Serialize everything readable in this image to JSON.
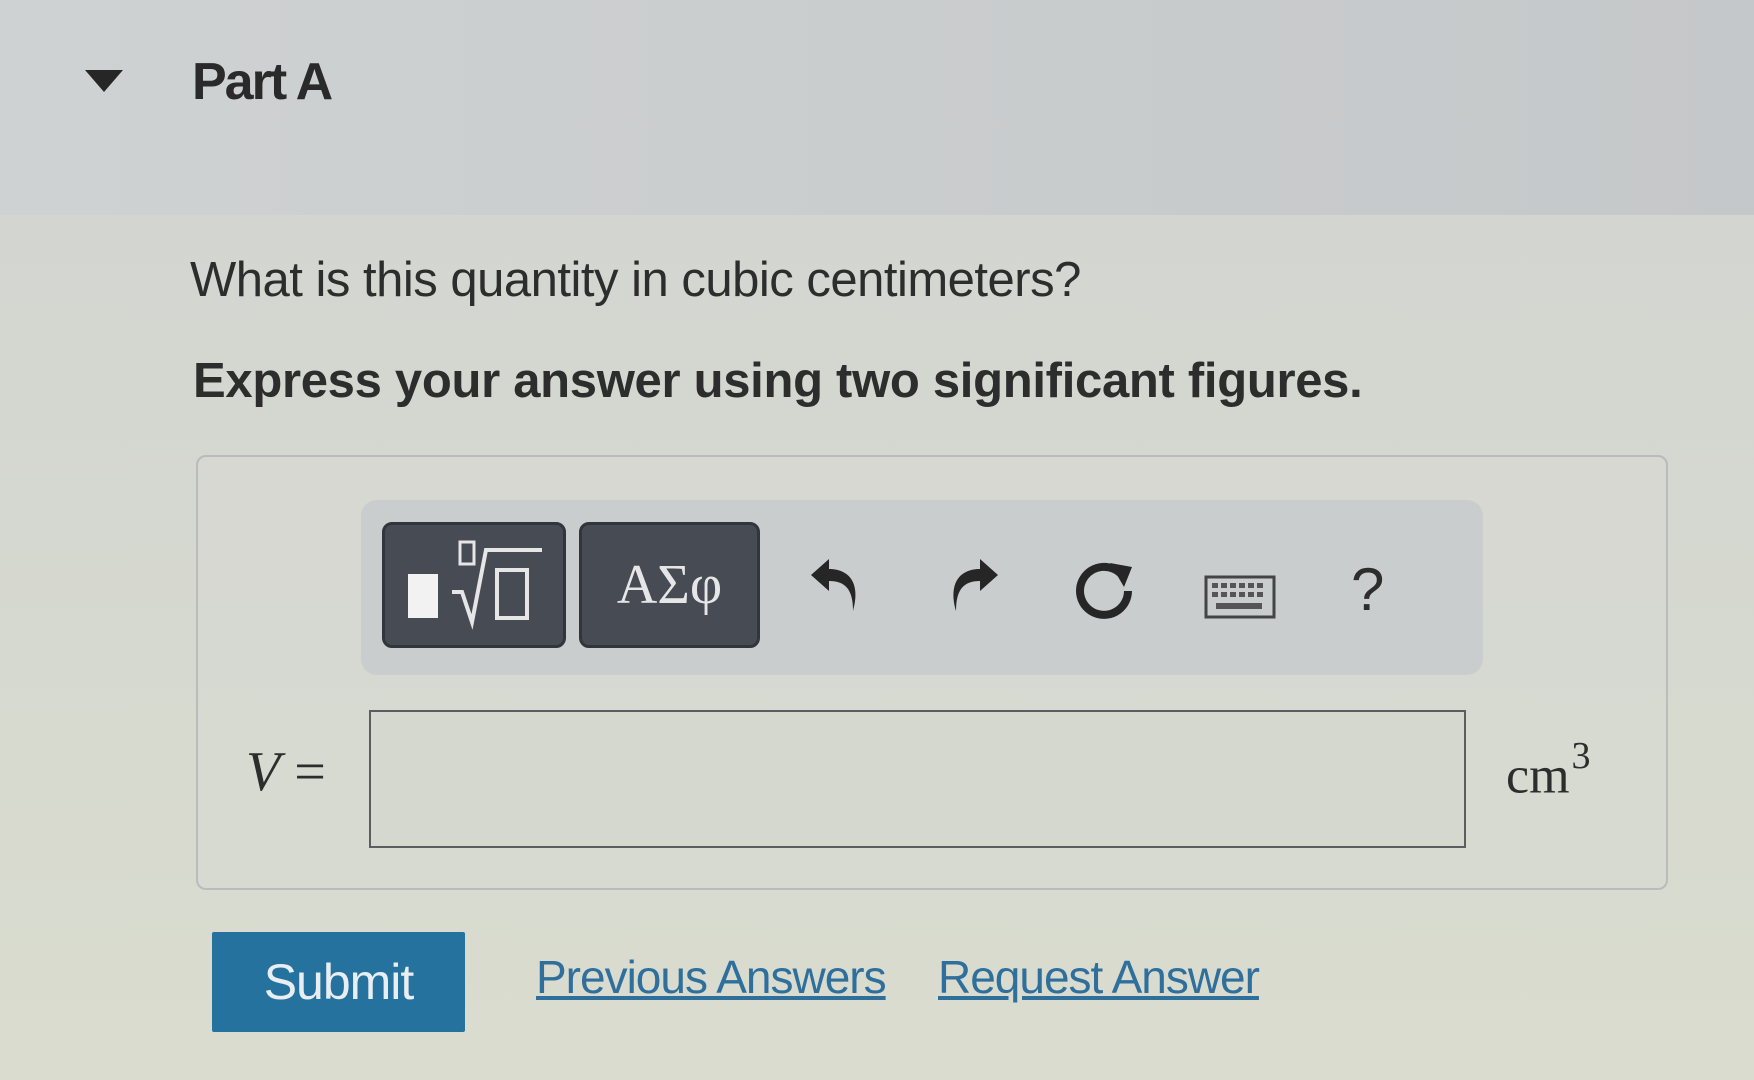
{
  "part": {
    "title": "Part A",
    "toggle_icon": "caret-down-icon"
  },
  "question": {
    "prompt": "What is this quantity in cubic centimeters?",
    "instruction": "Express your answer using two significant figures."
  },
  "toolbar": {
    "templates_icon": "templates-sqrt-icon",
    "greek_label": "ΑΣφ",
    "undo_icon": "undo-icon",
    "redo_icon": "redo-icon",
    "reset_icon": "reset-icon",
    "keyboard_icon": "keyboard-icon",
    "help_label": "?"
  },
  "answer": {
    "variable": "V",
    "equals": " =",
    "value": "",
    "unit_base": "cm",
    "unit_exponent": "3"
  },
  "actions": {
    "submit_label": "Submit",
    "previous_answers_label": "Previous Answers",
    "request_answer_label": "Request Answer"
  },
  "colors": {
    "submit_bg": "#25729f",
    "link": "#2f6f9c",
    "tool_dark": "#474b54"
  }
}
